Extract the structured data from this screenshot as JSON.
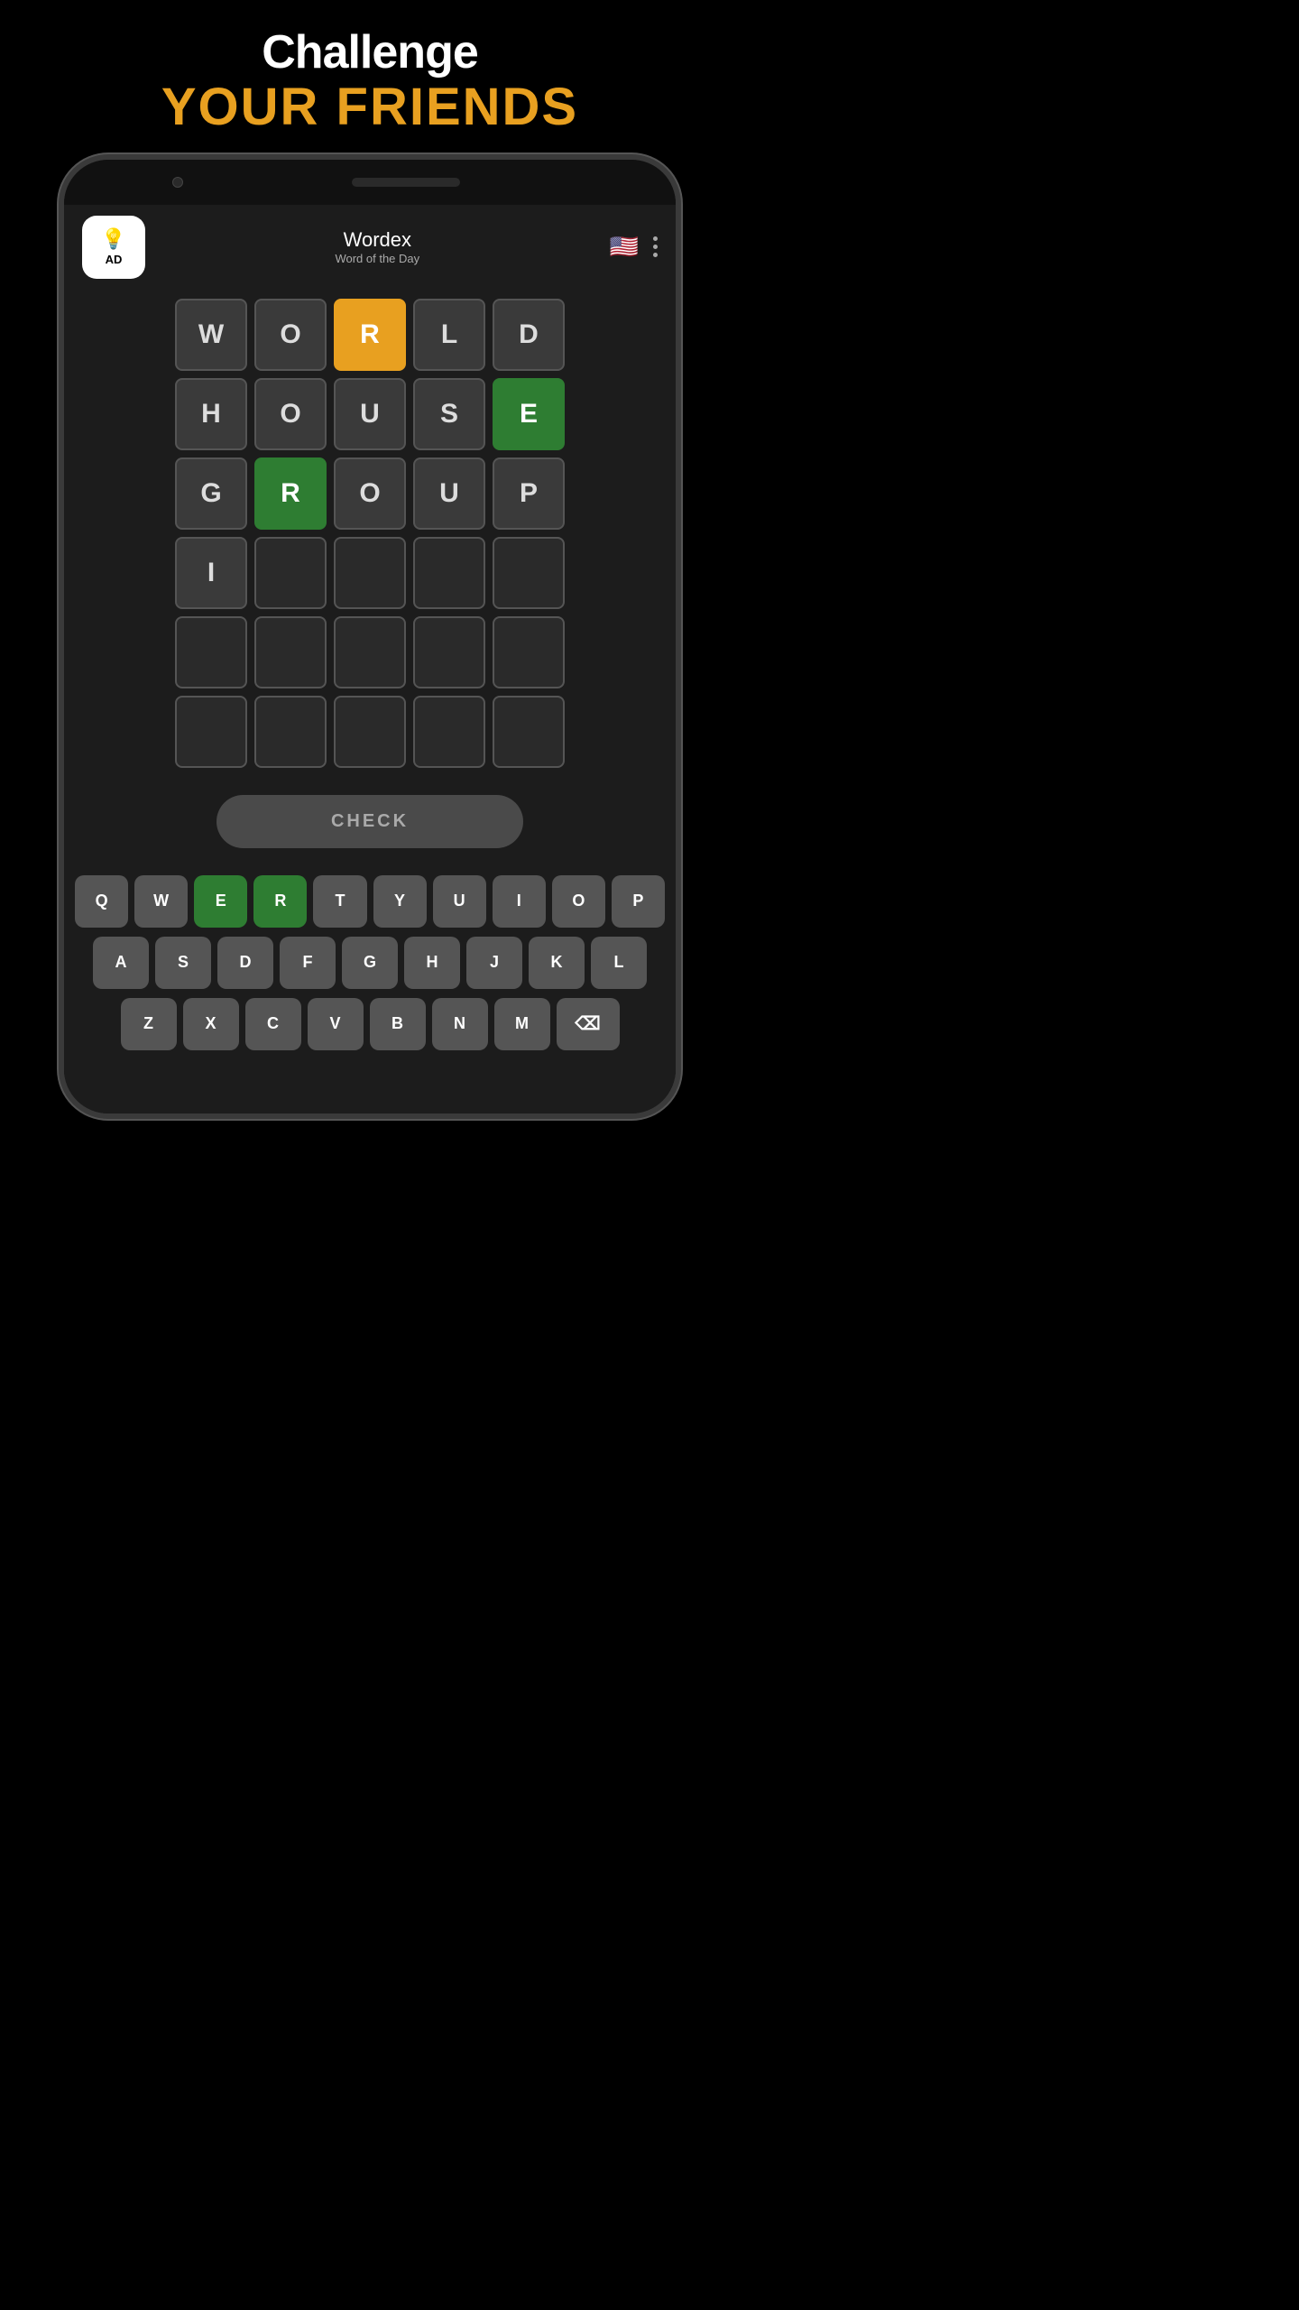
{
  "header": {
    "line1": "Challenge",
    "line2": "YOUR FRIENDS"
  },
  "app": {
    "title": "Wordex",
    "subtitle": "Word of the Day",
    "ad_label": "AD"
  },
  "grid": {
    "rows": [
      [
        {
          "letter": "W",
          "state": "normal"
        },
        {
          "letter": "O",
          "state": "normal"
        },
        {
          "letter": "R",
          "state": "orange"
        },
        {
          "letter": "L",
          "state": "normal"
        },
        {
          "letter": "D",
          "state": "normal"
        }
      ],
      [
        {
          "letter": "H",
          "state": "normal"
        },
        {
          "letter": "O",
          "state": "normal"
        },
        {
          "letter": "U",
          "state": "normal"
        },
        {
          "letter": "S",
          "state": "normal"
        },
        {
          "letter": "E",
          "state": "green"
        }
      ],
      [
        {
          "letter": "G",
          "state": "normal"
        },
        {
          "letter": "R",
          "state": "green"
        },
        {
          "letter": "O",
          "state": "normal"
        },
        {
          "letter": "U",
          "state": "normal"
        },
        {
          "letter": "P",
          "state": "normal"
        }
      ],
      [
        {
          "letter": "I",
          "state": "normal"
        },
        {
          "letter": "",
          "state": "empty"
        },
        {
          "letter": "",
          "state": "empty"
        },
        {
          "letter": "",
          "state": "empty"
        },
        {
          "letter": "",
          "state": "empty"
        }
      ],
      [
        {
          "letter": "",
          "state": "empty"
        },
        {
          "letter": "",
          "state": "empty"
        },
        {
          "letter": "",
          "state": "empty"
        },
        {
          "letter": "",
          "state": "empty"
        },
        {
          "letter": "",
          "state": "empty"
        }
      ],
      [
        {
          "letter": "",
          "state": "empty"
        },
        {
          "letter": "",
          "state": "empty"
        },
        {
          "letter": "",
          "state": "empty"
        },
        {
          "letter": "",
          "state": "empty"
        },
        {
          "letter": "",
          "state": "empty"
        }
      ]
    ]
  },
  "check_button": {
    "label": "CHECK"
  },
  "keyboard": {
    "row1": [
      {
        "key": "Q",
        "state": "normal"
      },
      {
        "key": "W",
        "state": "normal"
      },
      {
        "key": "E",
        "state": "green"
      },
      {
        "key": "R",
        "state": "green"
      },
      {
        "key": "T",
        "state": "normal"
      },
      {
        "key": "Y",
        "state": "normal"
      },
      {
        "key": "U",
        "state": "normal"
      },
      {
        "key": "I",
        "state": "normal"
      },
      {
        "key": "O",
        "state": "normal"
      },
      {
        "key": "P",
        "state": "normal"
      }
    ],
    "row2": [
      {
        "key": "A",
        "state": "normal"
      },
      {
        "key": "S",
        "state": "normal"
      },
      {
        "key": "D",
        "state": "normal"
      },
      {
        "key": "F",
        "state": "normal"
      },
      {
        "key": "G",
        "state": "normal"
      },
      {
        "key": "H",
        "state": "normal"
      },
      {
        "key": "J",
        "state": "normal"
      },
      {
        "key": "K",
        "state": "normal"
      },
      {
        "key": "L",
        "state": "normal"
      }
    ],
    "row3": [
      {
        "key": "Z",
        "state": "normal"
      },
      {
        "key": "X",
        "state": "normal"
      },
      {
        "key": "C",
        "state": "normal"
      },
      {
        "key": "V",
        "state": "normal"
      },
      {
        "key": "B",
        "state": "normal"
      },
      {
        "key": "N",
        "state": "normal"
      },
      {
        "key": "M",
        "state": "normal"
      },
      {
        "key": "⌫",
        "state": "backspace"
      }
    ]
  }
}
